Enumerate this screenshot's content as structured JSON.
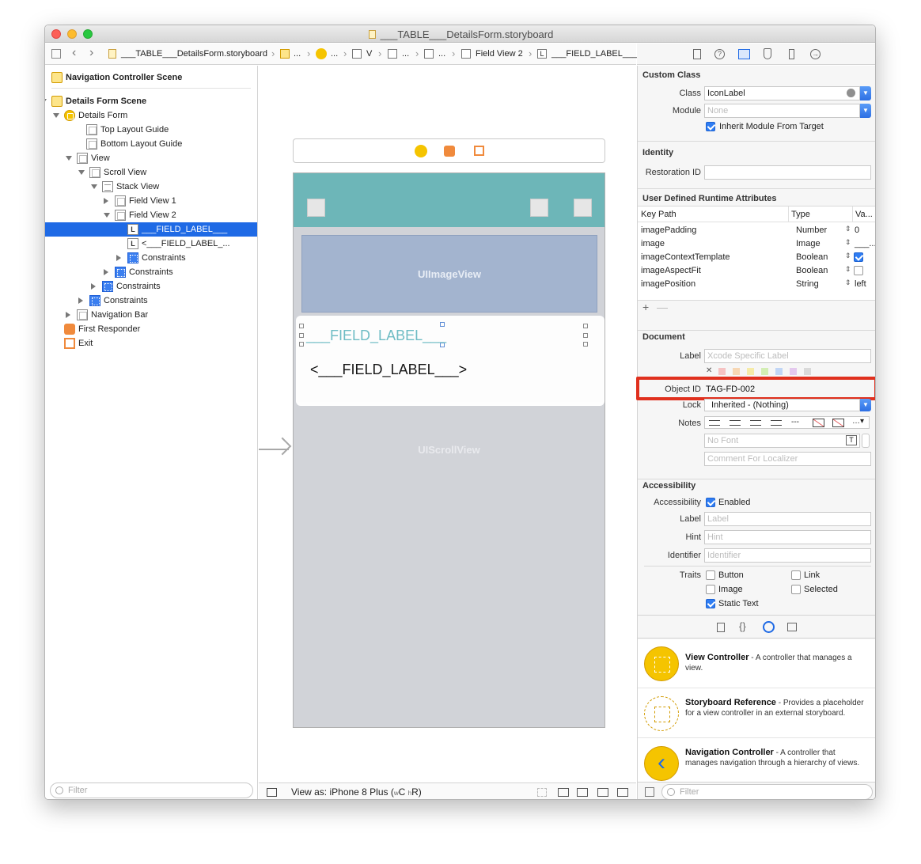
{
  "window": {
    "title": "___TABLE___DetailsForm.storyboard"
  },
  "jumpbar": {
    "crumbs": [
      "___TABLE___DetailsForm.storyboard",
      "...",
      "...",
      "V",
      "...",
      "...",
      "Field View 2",
      "___FIELD_LABEL___"
    ],
    "label_icon_glyph": "L"
  },
  "navigator": {
    "items": [
      {
        "label": "Navigation Controller Scene",
        "icon": "scene-icon"
      },
      {
        "label": "Details Form Scene",
        "icon": "scene-icon"
      },
      {
        "label": "Details Form",
        "icon": "view-controller-icon"
      },
      {
        "label": "Top Layout Guide",
        "icon": "layout-guide-icon"
      },
      {
        "label": "Bottom Layout Guide",
        "icon": "layout-guide-icon"
      },
      {
        "label": "View",
        "icon": "view-icon"
      },
      {
        "label": "Scroll View",
        "icon": "view-icon"
      },
      {
        "label": "Stack View",
        "icon": "stack-view-icon"
      },
      {
        "label": "Field View 1",
        "icon": "view-icon"
      },
      {
        "label": "Field View 2",
        "icon": "view-icon"
      },
      {
        "label": "___FIELD_LABEL___",
        "icon": "label-icon"
      },
      {
        "label": "<___FIELD_LABEL_...",
        "icon": "label-icon"
      },
      {
        "label": "Constraints",
        "icon": "constraints-icon"
      },
      {
        "label": "Constraints",
        "icon": "constraints-icon"
      },
      {
        "label": "Constraints",
        "icon": "constraints-icon"
      },
      {
        "label": "Constraints",
        "icon": "constraints-icon"
      },
      {
        "label": "Navigation Bar",
        "icon": "navigation-bar-icon"
      },
      {
        "label": "First Responder",
        "icon": "first-responder-icon"
      },
      {
        "label": "Exit",
        "icon": "exit-icon"
      }
    ],
    "selected_index": 10,
    "filter_placeholder": "Filter"
  },
  "canvas": {
    "imageview_label": "UIImageView",
    "field_label": "___FIELD_LABEL___",
    "field_value": "<___FIELD_LABEL___>",
    "scrollview_label": "UIScrollView",
    "view_as": "View as: iPhone 8 Plus (",
    "size_class_w": "w",
    "size_class_c": "C",
    "size_class_h": "h",
    "size_class_r": "R)",
    "colors": {
      "navbar": "#6db6b8",
      "imageview": "#a3b4cf",
      "field_label": "#6bbcc4",
      "scroll_bg": "#d1d3d8"
    }
  },
  "inspector": {
    "custom_class": {
      "header": "Custom Class",
      "class_label": "Class",
      "class_value": "IconLabel",
      "module_label": "Module",
      "module_placeholder": "None",
      "inherit_label": "Inherit Module From Target"
    },
    "identity": {
      "header": "Identity",
      "restoration_label": "Restoration ID"
    },
    "runtime_attrs": {
      "header": "User Defined Runtime Attributes",
      "col_keypath": "Key Path",
      "col_type": "Type",
      "col_value": "Va...",
      "rows": [
        {
          "key": "imagePadding",
          "type": "Number",
          "value": "0"
        },
        {
          "key": "image",
          "type": "Image",
          "value": "___..."
        },
        {
          "key": "imageContextTemplate",
          "type": "Boolean",
          "value": ""
        },
        {
          "key": "imageAspectFit",
          "type": "Boolean",
          "value": ""
        },
        {
          "key": "imagePosition",
          "type": "String",
          "value": "left"
        }
      ]
    },
    "document": {
      "header": "Document",
      "label_label": "Label",
      "label_placeholder": "Xcode Specific Label",
      "object_id_label": "Object ID",
      "object_id_value": "TAG-FD-002",
      "lock_label": "Lock",
      "lock_value": "Inherited - (Nothing)",
      "notes_label": "Notes",
      "font_placeholder": "No Font",
      "comment_placeholder": "Comment For Localizer",
      "highlight_color": "#e0301e"
    },
    "accessibility": {
      "header": "Accessibility",
      "accessibility_label": "Accessibility",
      "enabled_label": "Enabled",
      "label_label": "Label",
      "label_placeholder": "Label",
      "hint_label": "Hint",
      "hint_placeholder": "Hint",
      "identifier_label": "Identifier",
      "identifier_placeholder": "Identifier",
      "traits_label": "Traits",
      "traits": [
        {
          "label": "Button",
          "checked": false
        },
        {
          "label": "Link",
          "checked": false
        },
        {
          "label": "Image",
          "checked": false
        },
        {
          "label": "Selected",
          "checked": false
        },
        {
          "label": "Static Text",
          "checked": true
        }
      ]
    },
    "library": {
      "items": [
        {
          "title": "View Controller",
          "desc": " - A controller that manages a view."
        },
        {
          "title": "Storyboard Reference",
          "desc": " - Provides a placeholder for a view controller in an external storyboard."
        },
        {
          "title": "Navigation Controller",
          "desc": " - A controller that manages navigation through a hierarchy of views."
        }
      ],
      "filter_placeholder": "Filter"
    }
  }
}
